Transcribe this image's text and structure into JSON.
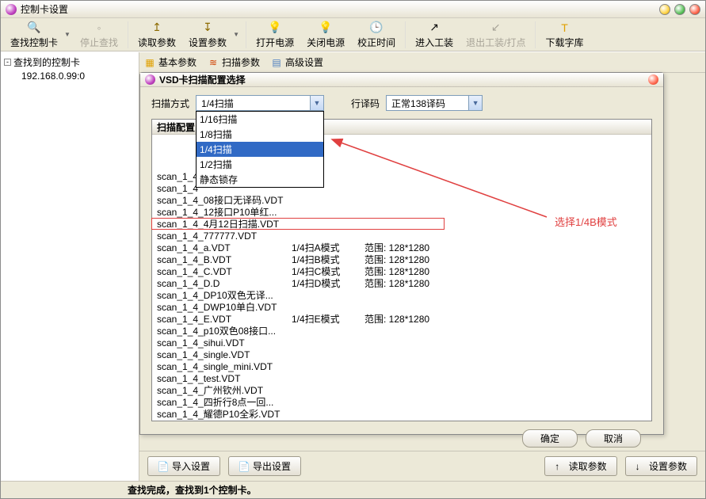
{
  "window": {
    "title": "控制卡设置"
  },
  "toolbar": {
    "find": "查找控制卡",
    "stop": "停止查找",
    "read": "读取参数",
    "set": "设置参数",
    "open_power": "打开电源",
    "close_power": "关闭电源",
    "adjust_time": "校正时间",
    "enter_tool": "进入工装",
    "exit_tool": "退出工装/打点",
    "download_font": "下载字库"
  },
  "tree": {
    "root": "查找到的控制卡",
    "child": "192.168.0.99:0"
  },
  "tabs": {
    "basic": "基本参数",
    "scan": "扫描参数",
    "advanced": "高级设置"
  },
  "footer": {
    "import": "导入设置",
    "export": "导出设置",
    "read": "读取参数",
    "set": "设置参数"
  },
  "status": "查找完成，查找到1个控制卡。",
  "dialog": {
    "title": "VSD卡扫描配置选择",
    "scan_mode_label": "扫描方式",
    "scan_mode_value": "1/4扫描",
    "scan_options": [
      "1/16扫描",
      "1/8扫描",
      "1/4扫描",
      "1/2扫描",
      "静态锁存"
    ],
    "row_decode_label": "行译码",
    "row_decode_value": "正常138译码",
    "list_header": "扫描配置",
    "rows": [
      {
        "name": "scan_1_4",
        "mode": "",
        "range": ""
      },
      {
        "name": "scan_1_4",
        "mode": "",
        "range": ""
      },
      {
        "name": "scan_1_4_08接口无译码.VDT",
        "mode": "",
        "range": ""
      },
      {
        "name": "scan_1_4_12接口P10单红...",
        "mode": "",
        "range": ""
      },
      {
        "name": "scan_1_4_4月12日扫描.VDT",
        "mode": "",
        "range": ""
      },
      {
        "name": "scan_1_4_777777.VDT",
        "mode": "",
        "range": ""
      },
      {
        "name": "scan_1_4_a.VDT",
        "mode": "1/4扫A模式",
        "range": "范围: 128*1280"
      },
      {
        "name": "scan_1_4_B.VDT",
        "mode": "1/4扫B模式",
        "range": "范围: 128*1280"
      },
      {
        "name": "scan_1_4_C.VDT",
        "mode": "1/4扫C模式",
        "range": "范围: 128*1280"
      },
      {
        "name": "scan_1_4_D.D",
        "mode": "1/4扫D模式",
        "range": "范围: 128*1280"
      },
      {
        "name": "scan_1_4_DP10双色无译...",
        "mode": "",
        "range": ""
      },
      {
        "name": "scan_1_4_DWP10单白.VDT",
        "mode": "",
        "range": ""
      },
      {
        "name": "scan_1_4_E.VDT",
        "mode": "1/4扫E模式",
        "range": "范围: 128*1280"
      },
      {
        "name": "scan_1_4_p10双色08接口...",
        "mode": "",
        "range": ""
      },
      {
        "name": "scan_1_4_sihui.VDT",
        "mode": "",
        "range": ""
      },
      {
        "name": "scan_1_4_single.VDT",
        "mode": "",
        "range": ""
      },
      {
        "name": "scan_1_4_single_mini.VDT",
        "mode": "",
        "range": ""
      },
      {
        "name": "scan_1_4_test.VDT",
        "mode": "",
        "range": ""
      },
      {
        "name": "scan_1_4_广州钦州.VDT",
        "mode": "",
        "range": ""
      },
      {
        "name": "scan_1_4_四折行8点一回...",
        "mode": "",
        "range": ""
      },
      {
        "name": "scan_1_4_耀德P10全彩.VDT",
        "mode": "",
        "range": ""
      }
    ],
    "ok": "确定",
    "cancel": "取消"
  },
  "annotation": {
    "label": "选择1/4B模式"
  }
}
